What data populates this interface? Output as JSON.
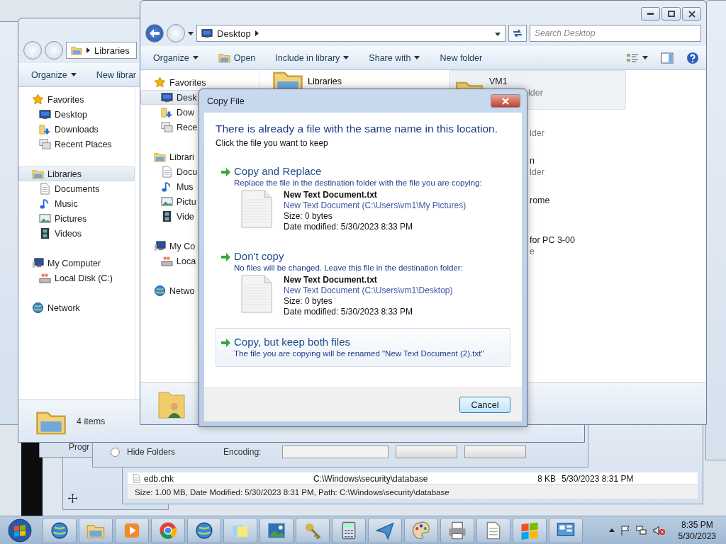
{
  "libraries_window": {
    "address": "Libraries",
    "toolbar": [
      {
        "label": "Organize",
        "dropdown": true
      },
      {
        "label": "New librar"
      }
    ],
    "nav": [
      {
        "label": "Favorites",
        "kind": "star",
        "selected": false,
        "children": [
          {
            "label": "Desktop",
            "kind": "monitor",
            "selected": false
          },
          {
            "label": "Downloads",
            "kind": "folder-arrow",
            "selected": false
          },
          {
            "label": "Recent Places",
            "kind": "window-stack",
            "selected": false
          }
        ]
      },
      {
        "label": "Libraries",
        "kind": "folder",
        "selected": true,
        "children": [
          {
            "label": "Documents",
            "kind": "document",
            "selected": false
          },
          {
            "label": "Music",
            "kind": "music-note",
            "selected": false
          },
          {
            "label": "Pictures",
            "kind": "picture",
            "selected": false
          },
          {
            "label": "Videos",
            "kind": "film",
            "selected": false
          }
        ]
      },
      {
        "label": "My Computer",
        "kind": "computer",
        "selected": false,
        "children": [
          {
            "label": "Local Disk (C:)",
            "kind": "drive",
            "selected": false
          }
        ]
      },
      {
        "label": "Network",
        "kind": "globe",
        "selected": false
      }
    ],
    "status": "4 items"
  },
  "explorer_window": {
    "address": "Desktop",
    "search": {
      "placeholder": "Search Desktop"
    },
    "toolbar": [
      {
        "label": "Organize",
        "dropdown": true
      },
      {
        "label": "Open",
        "dropdown": false,
        "kind": "folder"
      },
      {
        "label": "Include in library",
        "dropdown": true
      },
      {
        "label": "Share with",
        "dropdown": true
      },
      {
        "label": "New folder",
        "dropdown": false
      }
    ],
    "nav": [
      {
        "label": "Favorites",
        "kind": "star",
        "selected": false,
        "children": [
          {
            "label": "Desk",
            "kind": "monitor",
            "selected": true
          },
          {
            "label": "Dow",
            "kind": "folder-arrow",
            "selected": false
          },
          {
            "label": "Rece",
            "kind": "window-stack",
            "selected": false
          }
        ]
      },
      {
        "label": "Librari",
        "kind": "folder",
        "selected": false,
        "children": [
          {
            "label": "Docu",
            "kind": "document",
            "selected": false
          },
          {
            "label": "Mus",
            "kind": "music-note",
            "selected": false
          },
          {
            "label": "Pictu",
            "kind": "picture",
            "selected": false
          },
          {
            "label": "Vide",
            "kind": "film",
            "selected": false
          }
        ]
      },
      {
        "label": "My Co",
        "kind": "computer",
        "selected": false,
        "children": [
          {
            "label": "Loca",
            "kind": "drive",
            "selected": false
          }
        ]
      },
      {
        "label": "Netwo",
        "kind": "globe",
        "selected": false
      }
    ],
    "items": [
      {
        "name": "Libraries",
        "kind": "folder"
      }
    ],
    "tiles": [
      {
        "kind": "folder",
        "title": "VM1",
        "subtitle": "lder",
        "selected": true
      },
      {
        "subtitle": "lder",
        "selected": false
      },
      {
        "title": "n",
        "subtitle": "lder",
        "selected": false
      },
      {
        "title": "rome",
        "selected": false
      },
      {
        "title": "for PC 3-00",
        "subtitle": "e",
        "selected": false
      }
    ]
  },
  "copy_dialog": {
    "title": "Copy File",
    "heading": "There is already a file with the same name in this location.",
    "instruction": "Click the file you want to keep",
    "options": [
      {
        "title": "Copy and Replace",
        "description": "Replace the file in the destination folder with the file you are copying:",
        "hovered": false,
        "file": {
          "name": "New Text Document.txt",
          "path": "New Text Document (C:\\Users\\vm1\\My Pictures)",
          "size": "Size: 0 bytes",
          "date": "Date modified: 5/30/2023 8:33 PM"
        }
      },
      {
        "title": "Don't copy",
        "description": "No files will be changed. Leave this file in the destination folder:",
        "hovered": false,
        "file": {
          "name": "New Text Document.txt",
          "path": "New Text Document (C:\\Users\\vm1\\Desktop)",
          "size": "Size: 0 bytes",
          "date": "Date modified: 5/30/2023 8:33 PM"
        }
      },
      {
        "title": "Copy, but keep both files",
        "description": "The file you are copying will be renamed \"New Text Document (2).txt\"",
        "hovered": true
      }
    ],
    "cancel": "Cancel"
  },
  "options_window": {
    "radio": {
      "label": "Hide Folders",
      "checked": false
    },
    "encoding_label": "Encoding:"
  },
  "program_window": {
    "label": "Progr"
  },
  "file_list_window": {
    "rows": [
      {
        "name": "edb.chk",
        "path": "C:\\Windows\\security\\database",
        "size": "8 KB",
        "date": "5/30/2023 8:31 PM"
      }
    ],
    "status": "Size: 1.00 MB, Date Modified: 5/30/2023 8:31 PM, Path: C:\\Windows\\security\\database"
  },
  "taskbar": {
    "apps": [
      {
        "kind": "globe"
      },
      {
        "kind": "folder"
      },
      {
        "kind": "play"
      },
      {
        "kind": "ring"
      },
      {
        "kind": "globe"
      },
      {
        "kind": "notes"
      },
      {
        "kind": "landscape"
      },
      {
        "kind": "keys"
      },
      {
        "kind": "calculator"
      },
      {
        "kind": "paper-plane"
      },
      {
        "kind": "palette"
      },
      {
        "kind": "printer"
      },
      {
        "kind": "document"
      },
      {
        "kind": "flag"
      },
      {
        "kind": "panel"
      }
    ],
    "clock": {
      "time": "8:35 PM",
      "date": "5/30/2023"
    }
  }
}
